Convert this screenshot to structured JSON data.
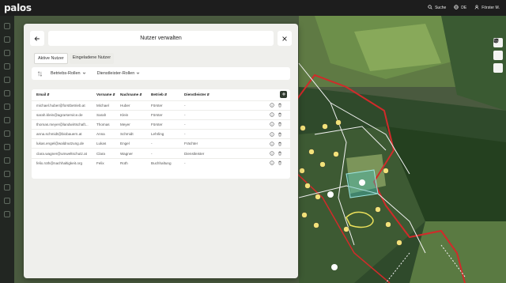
{
  "app": {
    "logo": "palos"
  },
  "header": {
    "search_label": "Suche",
    "language_label": "DE",
    "user_label": "Förster M."
  },
  "modal": {
    "title": "Nutzer verwalten",
    "tabs": [
      {
        "label": "Aktive Nutzer",
        "active": true
      },
      {
        "label": "Eingeladene Nutzer",
        "active": false
      }
    ],
    "filters": {
      "operator_roles": "Betriebs-Rollen",
      "service_roles": "Dienstleister-Rollen"
    },
    "table": {
      "columns": [
        "Email",
        "Vorname",
        "Nachname",
        "Betrieb",
        "Dienstleister"
      ],
      "rows": [
        {
          "email": "michael.huber@forstbetrieb.at",
          "first": "Michael",
          "last": "Huber",
          "operator": "Förster",
          "provider": "-"
        },
        {
          "email": "sarah.klein@agrarservice.de",
          "first": "Sarah",
          "last": "Klein",
          "operator": "Förster",
          "provider": "-"
        },
        {
          "email": "thomas.meyer@landwirtschaft...",
          "first": "Thomas",
          "last": "Meyer",
          "operator": "Förster",
          "provider": "-"
        },
        {
          "email": "anna.schmidt@biobauern.at",
          "first": "Anna",
          "last": "Schmidt",
          "operator": "Lehrling",
          "provider": "-"
        },
        {
          "email": "lukas.engel@waldnutzung.de",
          "first": "Lukas",
          "last": "Engel",
          "operator": "-",
          "provider": "Frächter"
        },
        {
          "email": "clara.wagner@umweltschutz.at",
          "first": "Clara",
          "last": "Wagner",
          "operator": "-",
          "provider": "Dienstleister"
        },
        {
          "email": "felix.roth@nachhaltigkeit.org",
          "first": "Felix",
          "last": "Roth",
          "operator": "Buchhaltung",
          "provider": "-"
        }
      ]
    }
  },
  "colors": {
    "topbar": "#1d1d1d",
    "modal_bg": "#efefec",
    "parcel_line": "#d22a2a",
    "marker": "#f2e27a",
    "selected_area": "#46b7b2",
    "highlight_path": "#ece15b"
  },
  "icons": {
    "search": "search-icon",
    "language": "globe-icon",
    "user": "user-icon",
    "back": "arrow-left-icon",
    "close": "close-icon",
    "add_user": "plus-icon",
    "info": "info-icon",
    "delete": "trash-icon"
  }
}
